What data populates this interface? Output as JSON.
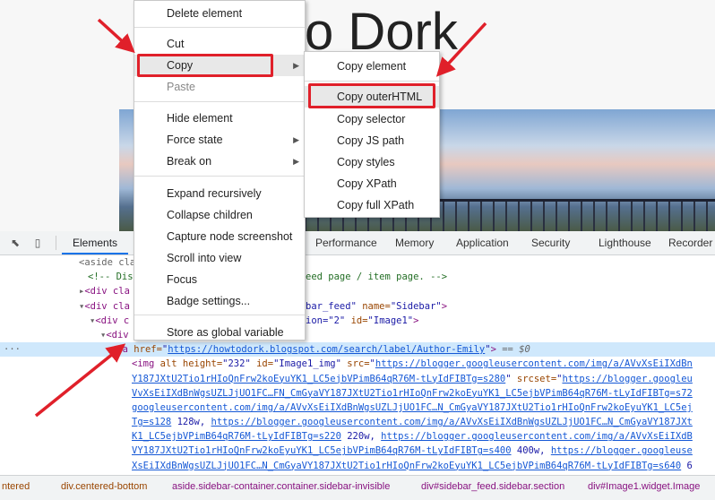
{
  "page": {
    "title_fragment": "o Dork"
  },
  "devtools": {
    "tabs": [
      "Elements",
      "Performance",
      "Memory",
      "Application",
      "Security",
      "Lighthouse",
      "Recorder"
    ],
    "code": {
      "l0": "<aside cla",
      "l1_a": "<!-- Dis",
      "l1_b": "eed page / item page. -->",
      "l2": "<div cla",
      "l3_a": "<div cla",
      "l3_b": "bar_feed\" ",
      "l3_c": "name=",
      "l3_d": "\"Sidebar\"",
      "l4_a": "<div c",
      "l4_b": "ion=\"2\" ",
      "l4_c": "id=",
      "l4_d": "\"Image1\"",
      "l5": "<div",
      "l6_tag": "<a ",
      "l6_attr": "href=",
      "l6_link": "https://howtodork.blogspot.com/search/label/Author-Emily",
      "l6_eq": "== $0",
      "l7_a": "<img ",
      "l7_b": "alt height=",
      "l7_c": "\"232\" ",
      "l7_d": "id=",
      "l7_e": "\"Image1_img\" ",
      "l7_f": "src=",
      "l7_g": "https://blogger.googleusercontent.com/img/a/AVvXsEiIXdBn",
      "l8_a": "Y187JXtU2Tio1rHIoQnFrw2koEyuYK1_LC5ejbVPimB64qR76M-tLyIdFIBTg=s280",
      "l8_b": " srcset=",
      "l8_c": "https://blogger.googleu",
      "l9": "VvXsEiIXdBnWgsUZLJjUO1FC…FN_CmGyaVY187JXtU2Tio1rHIoQnFrw2koEyuYK1_LC5ejbVPimB64qR76M-tLyIdFIBTg=s72",
      "l10": "googleusercontent.com/img/a/AVvXsEiIXdBnWgsUZLJjUO1FC…N_CmGyaVY187JXtU2Tio1rHIoQnFrw2koEyuYK1_LC5ej",
      "l11_a": "Tg=s128",
      "l11_b": " 128w, ",
      "l11_c": "https://blogger.googleusercontent.com/img/a/AVvXsEiIXdBnWgsUZLJjUO1FC…N_CmGyaVY187JXt",
      "l12_a": "K1_LC5ejbVPimB64qR76M-tLyIdFIBTg=s220",
      "l12_b": " 220w, ",
      "l12_c": "https://blogger.googleusercontent.com/img/a/AVvXsEiIXdB",
      "l13_a": "VY187JXtU2Tio1rHIoQnFrw2koEyuYK1_LC5ejbVPimB64qR76M-tLyIdFIBTg=s400",
      "l13_b": " 400w, ",
      "l13_c": "https://blogger.googleuse",
      "l14_a": "XsEiIXdBnWgsUZLJjUO1FC…N_CmGyaVY187JXtU2Tio1rHIoQnFrw2koEyuYK1_LC5ejbVPimB64qR76M-tLyIdFIBTg=s640",
      "l14_b": " 6"
    },
    "breadcrumbs": [
      "ntered",
      "div.centered-bottom",
      "aside.sidebar-container.container.sidebar-invisible",
      "div#sidebar_feed.sidebar.section",
      "div#Image1.widget.Image"
    ]
  },
  "context_menu": {
    "items": [
      "Delete element",
      "Cut",
      "Copy",
      "Paste",
      "Hide element",
      "Force state",
      "Break on",
      "Expand recursively",
      "Collapse children",
      "Capture node screenshot",
      "Scroll into view",
      "Focus",
      "Badge settings...",
      "Store as global variable"
    ]
  },
  "copy_submenu": {
    "items": [
      "Copy element",
      "Copy outerHTML",
      "Copy selector",
      "Copy JS path",
      "Copy styles",
      "Copy XPath",
      "Copy full XPath"
    ]
  },
  "colors": {
    "highlight": "#e0202a",
    "selected_row": "#cfe8fc",
    "tab_accent": "#1a73e8"
  }
}
